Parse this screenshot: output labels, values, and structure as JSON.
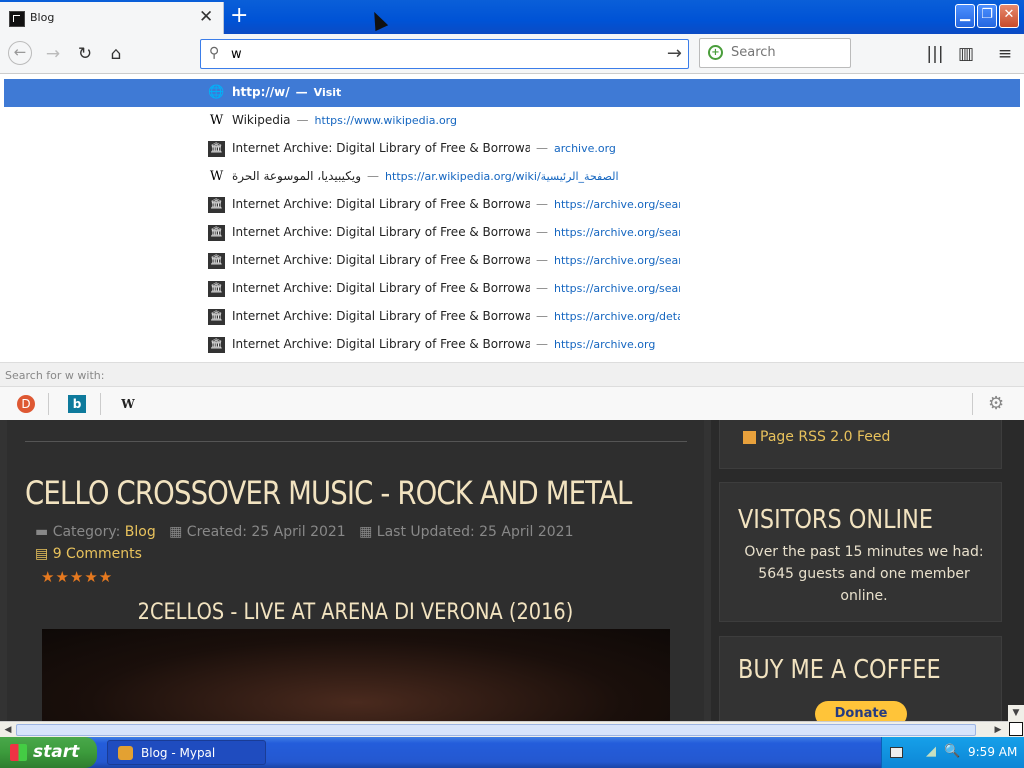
{
  "tab": {
    "title": "Blog",
    "close_glyph": "✕",
    "newtab_glyph": "+"
  },
  "window_buttons": {
    "minimize": "▁",
    "maximize": "❐",
    "close": "✕"
  },
  "nav": {
    "back": "←",
    "forward": "→",
    "reload": "↻",
    "home": "⌂",
    "library": "|||",
    "sidebar": "▥",
    "menu": "≡"
  },
  "urlbar": {
    "value": "w",
    "search_icon": "search-icon",
    "go_glyph": "→"
  },
  "searchbar": {
    "placeholder": "Search"
  },
  "suggestions": [
    {
      "title": "http://w/",
      "sep": "—",
      "url": "Visit",
      "icon": "globe-icon",
      "icon_glyph": "🌐"
    },
    {
      "title": "Wikipedia",
      "sep": "—",
      "url": "https://www.wikipedia.org",
      "icon": "wikipedia-icon",
      "icon_glyph": "W"
    },
    {
      "title": "Internet Archive: Digital Library of Free & Borrowable",
      "sep": "—",
      "url": "archive.org",
      "icon": "archive-icon",
      "icon_glyph": "🏛"
    },
    {
      "title": "ويكيبيديا، الموسوعة الحرة",
      "sep": "—",
      "url": "https://ar.wikipedia.org/wiki/الصفحة_الرئيسية",
      "icon": "wikipedia-icon",
      "icon_glyph": "W"
    },
    {
      "title": "Internet Archive: Digital Library of Free & Borrowable",
      "sep": "—",
      "url": "https://archive.org/search",
      "icon": "archive-icon",
      "icon_glyph": "🏛"
    },
    {
      "title": "Internet Archive: Digital Library of Free & Borrowable",
      "sep": "—",
      "url": "https://archive.org/search",
      "icon": "archive-icon",
      "icon_glyph": "🏛"
    },
    {
      "title": "Internet Archive: Digital Library of Free & Borrowable",
      "sep": "—",
      "url": "https://archive.org/search",
      "icon": "archive-icon",
      "icon_glyph": "🏛"
    },
    {
      "title": "Internet Archive: Digital Library of Free & Borrowable",
      "sep": "—",
      "url": "https://archive.org/search",
      "icon": "archive-icon",
      "icon_glyph": "🏛"
    },
    {
      "title": "Internet Archive: Digital Library of Free & Borrowable",
      "sep": "—",
      "url": "https://archive.org/details",
      "icon": "archive-icon",
      "icon_glyph": "🏛"
    },
    {
      "title": "Internet Archive: Digital Library of Free & Borrowable",
      "sep": "—",
      "url": "https://archive.org",
      "icon": "archive-icon",
      "icon_glyph": "🏛"
    }
  ],
  "search_for": "Search for w with:",
  "engines": {
    "ddg": "D",
    "bing": "b",
    "wiki": "W",
    "gear": "⚙"
  },
  "article": {
    "title": "CELLO CROSSOVER MUSIC - ROCK AND METAL",
    "category_label": "Category:",
    "category": "Blog",
    "created": "Created: 25 April 2021",
    "updated": "Last Updated: 25 April 2021",
    "comments": "9 Comments",
    "rating_stars": "★★★★★",
    "video_title": "2CELLOS - LIVE AT ARENA DI VERONA (2016)",
    "folder_icon": "folder-icon",
    "calendar_icon": "calendar-icon"
  },
  "sidebar": {
    "rss": "Page RSS 2.0 Feed",
    "visitors_title": "VISITORS ONLINE",
    "visitors_text": "Over the past 15 minutes we had: 5645 guests and one member online.",
    "coffee_title": "BUY ME A COFFEE",
    "donate": "Donate"
  },
  "scroll": {
    "left": "◀",
    "right": "▶",
    "down": "▼"
  },
  "taskbar": {
    "start": "start",
    "task": "Blog - Mypal",
    "clock": "9:59 AM",
    "search_glyph": "🔍",
    "vol_glyph": "◢"
  }
}
